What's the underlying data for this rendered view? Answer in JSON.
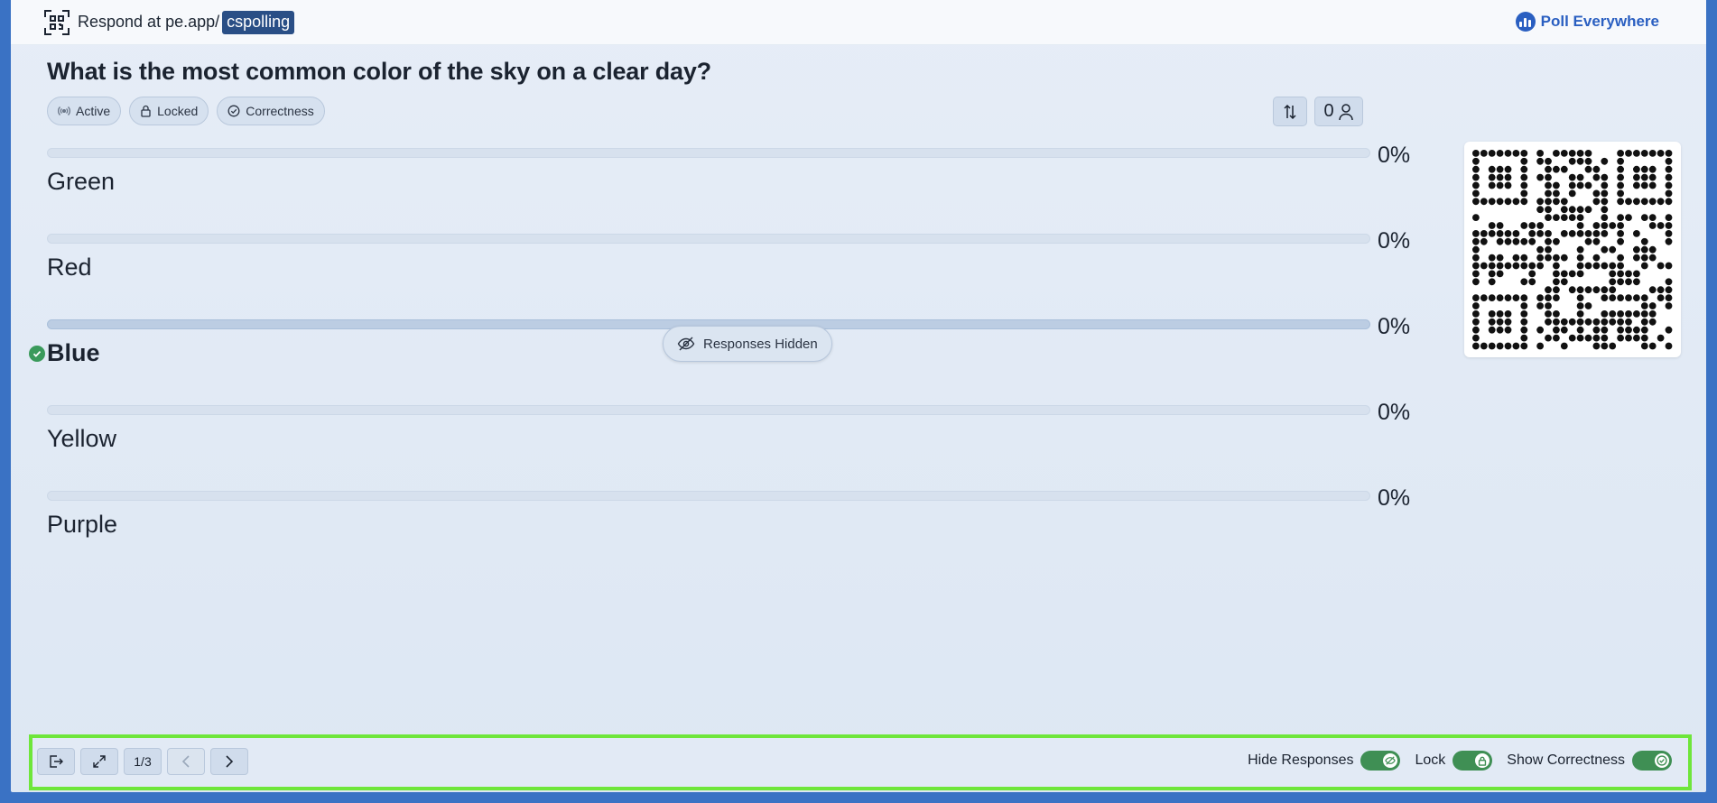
{
  "header": {
    "respond_prefix": "Respond at pe.app/",
    "code": "cspolling",
    "brand": "Poll Everywhere"
  },
  "poll": {
    "question": "What is the most common color of the sky on a clear day?",
    "status_chips": [
      {
        "label": "Active",
        "icon": "broadcast-icon"
      },
      {
        "label": "Locked",
        "icon": "lock-icon"
      },
      {
        "label": "Correctness",
        "icon": "check-circle-icon"
      }
    ],
    "response_count": "0",
    "responses_hidden_label": "Responses Hidden",
    "choices": [
      {
        "label": "Green",
        "percent": "0%",
        "correct": false,
        "fill": 0
      },
      {
        "label": "Red",
        "percent": "0%",
        "correct": false,
        "fill": 0
      },
      {
        "label": "Blue",
        "percent": "0%",
        "correct": true,
        "fill": 0
      },
      {
        "label": "Yellow",
        "percent": "0%",
        "correct": false,
        "fill": 0
      },
      {
        "label": "Purple",
        "percent": "0%",
        "correct": false,
        "fill": 0
      }
    ]
  },
  "footer": {
    "page_indicator": "1/3",
    "toggles": [
      {
        "label": "Hide Responses",
        "on": true,
        "icon": "eye-slash-icon"
      },
      {
        "label": "Lock",
        "on": true,
        "icon": "lock-icon"
      },
      {
        "label": "Show Correctness",
        "on": true,
        "icon": "check-circle-icon"
      }
    ]
  },
  "colors": {
    "accent": "#2a5fc1",
    "code_chip": "#2a4f86",
    "correct_green": "#3a9a5b",
    "toggle_on": "#3f8f54",
    "highlight_border": "#6ee63a"
  }
}
